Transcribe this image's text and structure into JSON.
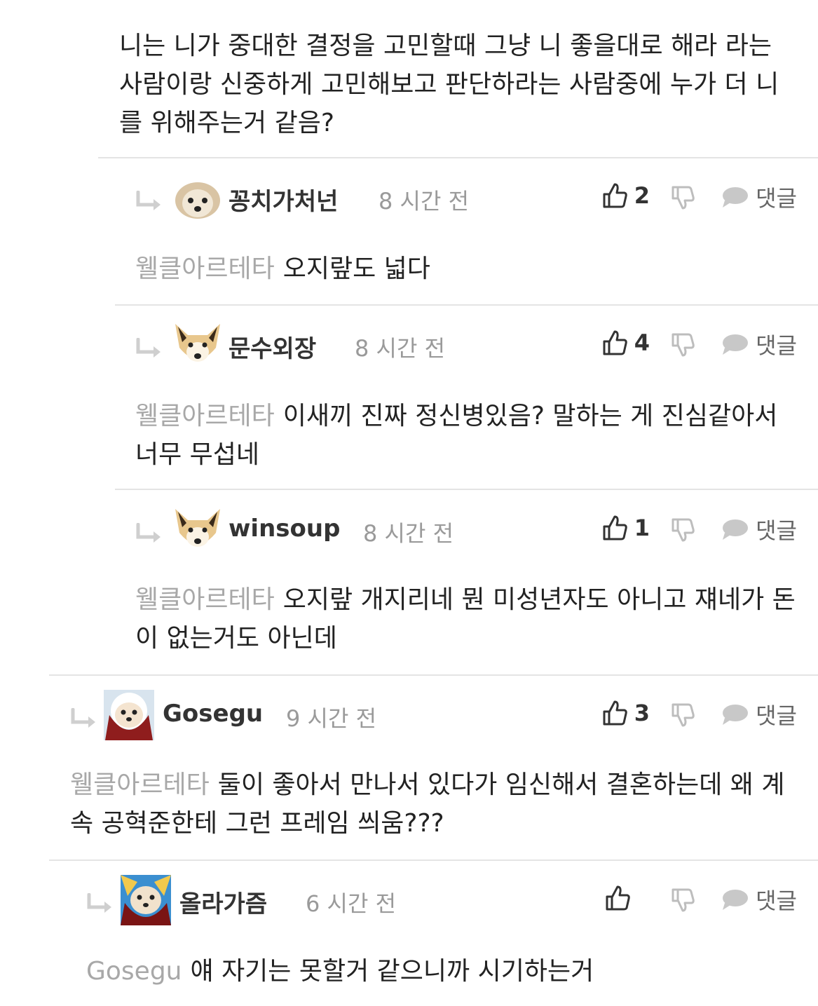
{
  "intro_text": "니는 니가 중대한 결정을 고민할때 그냥 니 좋을대로 해라 라는 사람이랑 신중하게 고민해보고 판단하라는 사람중에 누가 더 니를 위해주는거 같음?",
  "reply_label": "댓글",
  "comments": [
    {
      "user": "꽁치가처넌",
      "time": "8 시간 전",
      "likes": "2",
      "mention": "웰클아르테타",
      "text": "오지랖도 넓다"
    },
    {
      "user": "문수외장",
      "time": "8 시간 전",
      "likes": "4",
      "mention": "웰클아르테타",
      "text": "이새끼 진짜 정신병있음? 말하는 게 진심같아서 너무 무섭네"
    },
    {
      "user": "winsoup",
      "time": "8 시간 전",
      "likes": "1",
      "mention": "웰클아르테타",
      "text": "오지랖 개지리네 뭔 미성년자도 아니고 쟤네가 돈이 없는거도 아닌데"
    },
    {
      "user": "Gosegu",
      "time": "9 시간 전",
      "likes": "3",
      "mention": "웰클아르테타",
      "text": "둘이 좋아서 만나서 있다가 임신해서 결혼하는데 왜 계속 공혁준한테 그런 프레임 씌움???"
    },
    {
      "user": "올라가즘",
      "time": "6 시간 전",
      "likes": "",
      "mention": "Gosegu",
      "text": "얘 자기는 못할거 같으니까 시기하는거"
    }
  ],
  "icons": {
    "reply_arrow": "reply-arrow-icon",
    "like": "thumbs-up-icon",
    "dislike": "thumbs-down-icon",
    "comment": "speech-bubble-icon"
  },
  "colors": {
    "mention": "#a8a8a8",
    "meta": "#9a9a9a",
    "divider": "#e4e4e4"
  }
}
